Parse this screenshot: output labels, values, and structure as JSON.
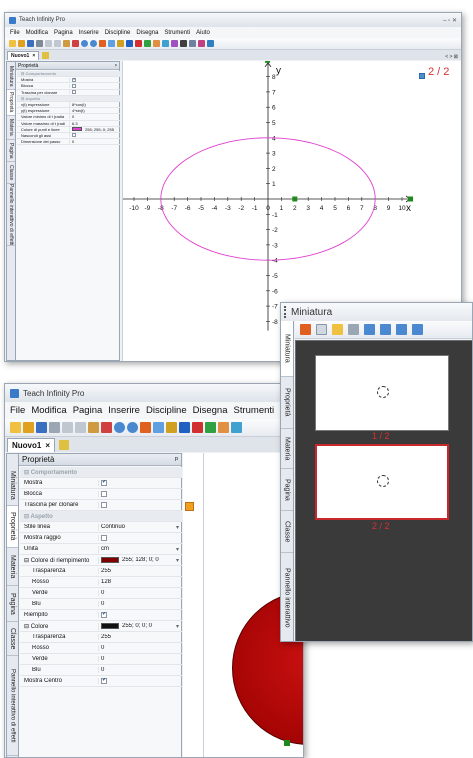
{
  "app": {
    "title": "Teach Infinity Pro",
    "menu": [
      "File",
      "Modifica",
      "Pagina",
      "Inserire",
      "Discipline",
      "Disegna",
      "Strumenti",
      "Aiuto"
    ],
    "doc_tab": "Nuovo1",
    "tab_close": "×"
  },
  "colors": {
    "ellipse": "#e040d0",
    "point": "#1e8a1e",
    "fill_circle": "#b00000",
    "page_badge": "#d83030"
  },
  "top": {
    "page_counter": "2 / 2",
    "nav_controls": "< > ⊠",
    "panel_title": "Proprietà",
    "pin": "ᵖ",
    "vtabs": [
      "Miniatura",
      "Proprietà",
      "Materia",
      "Pagina",
      "Classe",
      "Pannello interattivo di effetti"
    ],
    "props": [
      {
        "cat": true,
        "k": "Comportamento"
      },
      {
        "k": "Mostra",
        "check": true
      },
      {
        "k": "Blocca",
        "check": false
      },
      {
        "k": "Trascina per clonare",
        "check": false
      },
      {
        "cat": true,
        "k": "Aspetto"
      },
      {
        "k": "x(t) espressione",
        "v": "8*cos(t)"
      },
      {
        "k": "y(t) espressione",
        "v": "4*sin(t)"
      },
      {
        "k": "Valore minimo di t (radia",
        "v": "0"
      },
      {
        "k": "Valore massimo di t (radi",
        "v": "6.3"
      },
      {
        "k": "Colore di punti e linee",
        "v": "255; 255; 0; 255",
        "swatch": "#e040d0"
      },
      {
        "k": "Nascondi gli assi",
        "check": false
      },
      {
        "k": "Dimensione del passo",
        "v": "0"
      }
    ],
    "axis": {
      "x_label": "x",
      "y_label": "y",
      "x_ticks": [
        "-10",
        "-9",
        "-8",
        "-7",
        "-6",
        "-5",
        "-4",
        "-3",
        "-2",
        "-1",
        "0",
        "1",
        "2",
        "3",
        "4",
        "5",
        "6",
        "7",
        "8",
        "9",
        "10"
      ],
      "y_ticks_pos": [
        "8",
        "7",
        "6",
        "5",
        "4",
        "3",
        "2",
        "1"
      ],
      "y_ticks_neg": [
        "-1",
        "-2",
        "-3",
        "-4",
        "-5",
        "-6",
        "-7",
        "-8"
      ]
    }
  },
  "miniatura": {
    "title": "Miniatura",
    "vtabs": [
      "Miniatura",
      "Proprietà",
      "Materia",
      "Pagina",
      "Classe",
      "Pannello interattivo"
    ],
    "page1_label": "1 / 2",
    "page2_label": "2 / 2"
  },
  "bottom": {
    "panel_title": "Proprietà",
    "pin": "ᵖ",
    "vtabs": [
      "Miniatura",
      "Proprietà",
      "Materia",
      "Pagina",
      "Classe",
      "Pannello interattivo di effetti"
    ],
    "props": [
      {
        "cat": true,
        "k": "Comportamento"
      },
      {
        "k": "Mostra",
        "check": true
      },
      {
        "k": "Blocca",
        "check": false
      },
      {
        "k": "Trascina per clonare",
        "check": false
      },
      {
        "cat": true,
        "k": "Aspetto"
      },
      {
        "k": "Stile linea",
        "v": "Continuo",
        "dd": true
      },
      {
        "k": "Mostra raggio",
        "check": false
      },
      {
        "k": "Unità",
        "v": "cm",
        "dd": true
      },
      {
        "k": "Colore di riempimento",
        "v": "255; 128; 0; 0",
        "swatch": "#800000",
        "dd": true,
        "minus": true
      },
      {
        "k": "Trasparenza",
        "v": "255",
        "indent": true
      },
      {
        "k": "Rosso",
        "v": "128",
        "indent": true
      },
      {
        "k": "Verde",
        "v": "0",
        "indent": true
      },
      {
        "k": "Blu",
        "v": "0",
        "indent": true
      },
      {
        "k": "Riempito",
        "check": true
      },
      {
        "k": "Colore",
        "v": "255; 0; 0; 0",
        "swatch": "#111111",
        "dd": true,
        "minus": true
      },
      {
        "k": "Trasparenza",
        "v": "255",
        "indent": true
      },
      {
        "k": "Rosso",
        "v": "0",
        "indent": true
      },
      {
        "k": "Verde",
        "v": "0",
        "indent": true
      },
      {
        "k": "Blu",
        "v": "0",
        "indent": true
      },
      {
        "k": "Mostra Centro",
        "check": true
      }
    ]
  }
}
